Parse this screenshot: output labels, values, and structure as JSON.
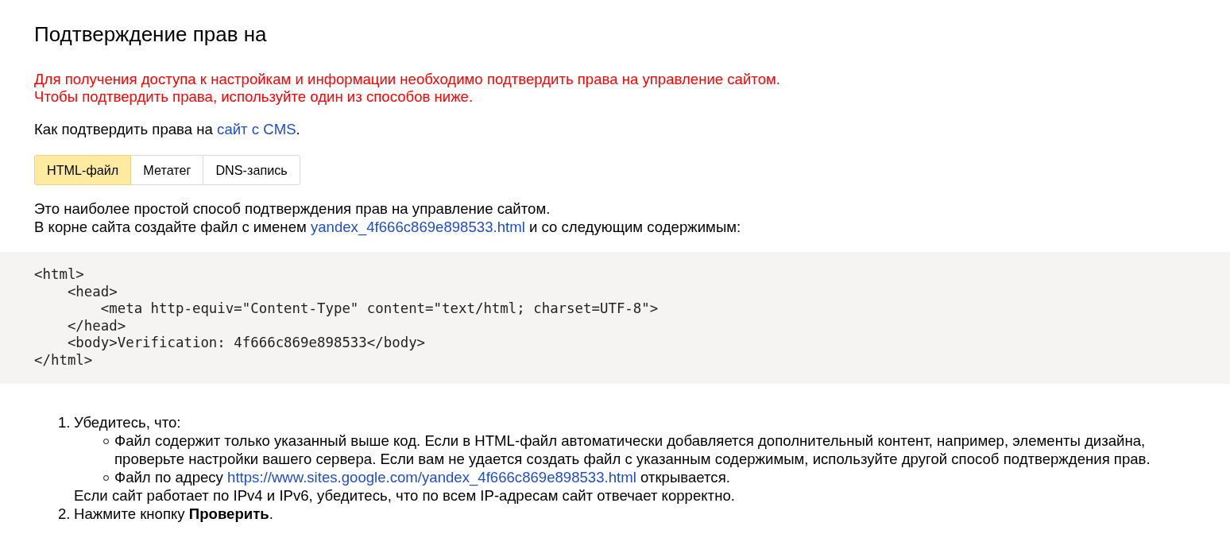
{
  "page": {
    "title": "Подтверждение прав на"
  },
  "warning": {
    "lines": [
      "Для получения доступа к настройкам и информации необходимо подтвердить права на управление сайтом.",
      "Чтобы подтвердить права, используйте один из способов ниже."
    ]
  },
  "intro": {
    "text": "Как подтвердить права на",
    "link": "сайт с CMS",
    "suffix": "."
  },
  "tabs": [
    {
      "label": "HTML-файл",
      "selected": true
    },
    {
      "label": "Метатег",
      "selected": false
    },
    {
      "label": "DNS-запись",
      "selected": false
    }
  ],
  "description": [
    {
      "text": "Это наиболее простой способ подтверждения прав на управление сайтом."
    },
    {
      "text": "В корне сайта создайте файл с именем",
      "link": "yandex_4f666c869e898533.html",
      "suffix": " и со следующим содержимым:"
    }
  ],
  "code": {
    "lines": [
      "<html>",
      "    <head>",
      "        <meta http-equiv=\"Content-Type\" content=\"text/html; charset=UTF-8\">",
      "    </head>",
      "    <body>Verification: 4f666c869e898533</body>",
      "</html>"
    ]
  },
  "steps": [
    {
      "number": "1.",
      "text": "Убедитесь, что:",
      "children": [
        {
          "text": "Файл содержит только указанный выше код. Если в HTML-файл автоматически добавляется дополнительный контент, например, элементы дизайна, проверьте настройки вашего сервера. Если вам не удается создать файл с указанным содержимым, используйте другой способ подтверждения прав."
        },
        {
          "text": "Файл по адресу",
          "link": "https://www.sites.google.com/yandex_4f666c869e898533.html",
          "suffix": " открывается."
        }
      ],
      "note": "Если сайт работает по IPv4 и IPv6, убедитесь, что по всем IP-адресам сайт отвечает корректно."
    },
    {
      "number": "2.",
      "text": "Нажмите кнопку **Проверить**."
    }
  ]
}
